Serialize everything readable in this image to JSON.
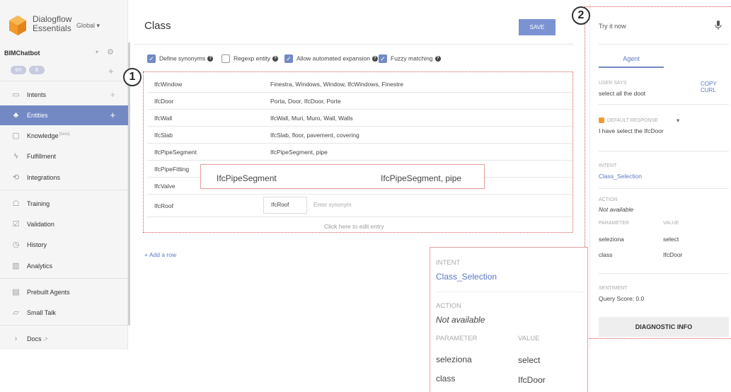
{
  "sidebar": {
    "brand_line1": "Dialogflow",
    "brand_line2": "Essentials",
    "region": "Global ▾",
    "agent_name": "BIMChatbot",
    "languages": [
      "en",
      "it"
    ],
    "items": [
      {
        "label": "Intents",
        "icon": "intents-icon",
        "plus": true
      },
      {
        "label": "Entities",
        "icon": "entities-icon",
        "plus": true,
        "active": true
      },
      {
        "label": "Knowledge",
        "icon": "knowledge-icon",
        "sup": "[beta]"
      },
      {
        "label": "Fulfillment",
        "icon": "fulfillment-icon"
      },
      {
        "label": "Integrations",
        "icon": "integrations-icon"
      },
      {
        "label": "Training",
        "icon": "training-icon"
      },
      {
        "label": "Validation",
        "icon": "validation-icon"
      },
      {
        "label": "History",
        "icon": "history-icon"
      },
      {
        "label": "Analytics",
        "icon": "analytics-icon"
      },
      {
        "label": "Prebuilt Agents",
        "icon": "prebuilt-agents-icon"
      },
      {
        "label": "Small Talk",
        "icon": "small-talk-icon"
      },
      {
        "label": "Docs",
        "icon": "docs-icon"
      }
    ],
    "accent": "#7389c4"
  },
  "main": {
    "title": "Class",
    "save_label": "SAVE",
    "options": [
      {
        "label": "Define synonyms",
        "checked": true
      },
      {
        "label": "Regexp entity",
        "checked": false
      },
      {
        "label": "Allow automated expansion",
        "checked": true
      },
      {
        "label": "Fuzzy matching",
        "checked": true
      }
    ],
    "entries": [
      {
        "key": "IfcWindow",
        "synonyms": "Finestra, Windows, Window, IfcWindows, Finestre"
      },
      {
        "key": "IfcDoor",
        "synonyms": "Porta, Door, IfcDoor, Porte"
      },
      {
        "key": "IfcWall",
        "synonyms": "IfcWall, Muri, Muro, Wall, Walls"
      },
      {
        "key": "IfcSlab",
        "synonyms": "IfcSlab, floor, pavement, covering"
      },
      {
        "key": "IfcPipeSegment",
        "synonyms": "IfcPipeSegment, pipe"
      },
      {
        "key": "IfcPipeFitting",
        "synonyms": ""
      },
      {
        "key": "IfcValve",
        "synonyms": ""
      }
    ],
    "popup": {
      "key": "IfcPipeSegment",
      "synonyms": "IfcPipeSegment, pipe"
    },
    "new_entry": {
      "key": "IfcRoof",
      "value": "IfcRoof",
      "placeholder": "Enter synonym"
    },
    "edit_hint": "Click here to edit entry",
    "add_row": "+ Add a row",
    "callout_1": "1",
    "callout_2": "2"
  },
  "panel": {
    "try_it": "Try it now",
    "tab": "Agent",
    "user_says_label": "USER SAYS",
    "copy_curl": "COPY CURL",
    "user_says": "select all the doot",
    "default_response_label": "DEFAULT RESPONSE",
    "default_response": "I have select the IfcDoor",
    "intent_label": "INTENT",
    "intent": "Class_Selection",
    "action_label": "ACTION",
    "action": "Not available",
    "parameter_label": "PARAMETER",
    "value_label": "VALUE",
    "params": [
      {
        "name": "seleziona",
        "value": "select"
      },
      {
        "name": "class",
        "value": "IfcDoor"
      }
    ],
    "sentiment_label": "SENTIMENT",
    "sentiment": "Query Score: 0.0",
    "diagnostic": "DIAGNOSTIC INFO"
  },
  "zoom": {
    "intent_label": "INTENT",
    "intent": "Class_Selection",
    "action_label": "ACTION",
    "action": "Not available",
    "parameter_label": "PARAMETER",
    "value_label": "VALUE",
    "params": [
      {
        "name": "seleziona",
        "value": "select"
      },
      {
        "name": "class",
        "value": "IfcDoor"
      }
    ]
  }
}
